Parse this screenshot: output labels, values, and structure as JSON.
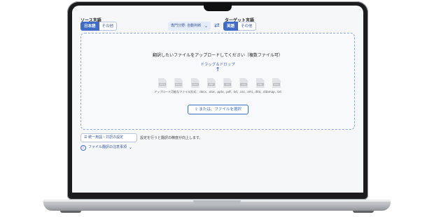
{
  "source": {
    "label": "ソース言語",
    "options": [
      "日本語",
      "その他"
    ],
    "selected": "日本語"
  },
  "target": {
    "label": "ターゲット言語",
    "options": [
      "英語",
      "その他"
    ],
    "selected": "英語"
  },
  "domain_select": {
    "value": "専門分野: 自動判断",
    "icon": "chevron-down-icon"
  },
  "swap_icon": "⇄",
  "dropzone": {
    "title": "翻訳したいファイルをアップロードしてください（複数ファイル可）",
    "drag_label": "ドラッグ＆ドロップ",
    "arrow": "↑",
    "file_types": [
      "PPTX",
      "DOCX",
      "XLSX",
      "PDF",
      "TXT",
      "CSV",
      "XML",
      "DITA"
    ],
    "formats_text": "アップロード可能なファイル形式：.docx, .xlsx, .pptx, .pdf, .txt, .csv, .xml, .dita, .ditamap, .txt",
    "select_button": "または、ファイルを選択",
    "select_icon": "upload-icon"
  },
  "glossary": {
    "button_label": "統一用語・対訳の設定",
    "note": "設定を行うと翻訳の精度が向上します。"
  },
  "notice": {
    "label": "ファイル翻訳の注意事項"
  },
  "colors": {
    "accent": "#3f6cc7",
    "background": "#f6f7f9",
    "bezel": "#1c1c1e"
  }
}
